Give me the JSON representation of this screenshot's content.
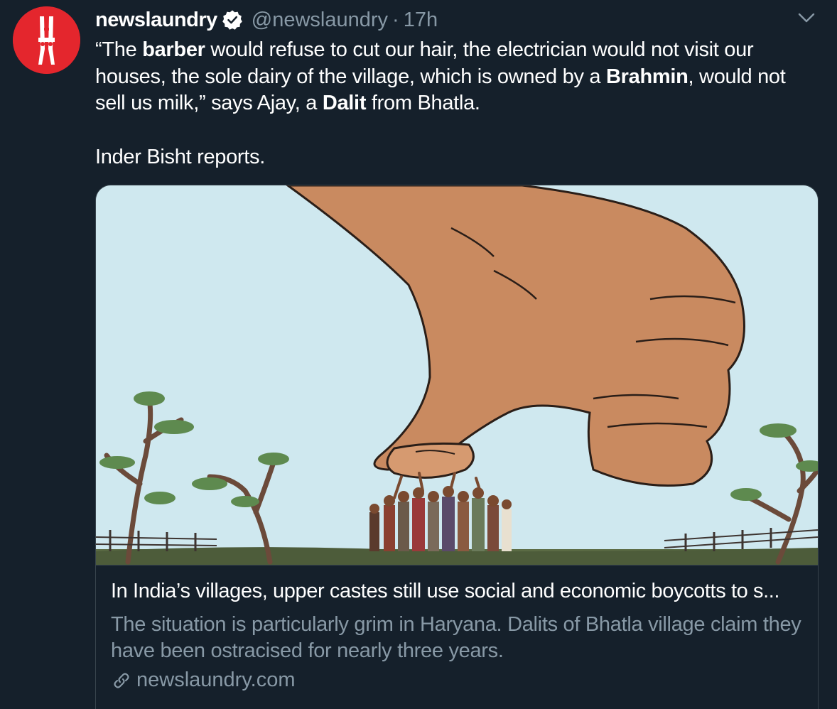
{
  "tweet": {
    "author": {
      "display_name": "newslaundry",
      "handle": "@newslaundry",
      "verified": true,
      "avatar_icon": "clothespin-logo-icon"
    },
    "separator": "·",
    "timestamp": "17h",
    "body": {
      "q_open": "“The ",
      "w_barber": "barber",
      "t1": " would refuse to cut our hair, the electrician would not visit our houses, the sole dairy of the village, which is owned by a ",
      "w_brahmin": "Brahmin",
      "t2": ", would not sell us milk,” says Ajay, a ",
      "w_dalit": "Dalit",
      "t3": " from Bhatla.",
      "para2": "Inder Bisht reports."
    },
    "card": {
      "image_icon": "illustration-hand-crushing-villagers",
      "title": "In India’s villages, upper castes still use social and economic boycotts to s...",
      "description": "The situation is particularly grim in Haryana. Dalits of Bhatla village claim they have been ostracised for nearly three years.",
      "domain": "newslaundry.com"
    }
  },
  "colors": {
    "background": "#15202b",
    "text_primary": "#ffffff",
    "text_secondary": "#8899a6",
    "border": "#38444d",
    "brand_red": "#e4262d",
    "verified_badge": "#ffffff"
  }
}
